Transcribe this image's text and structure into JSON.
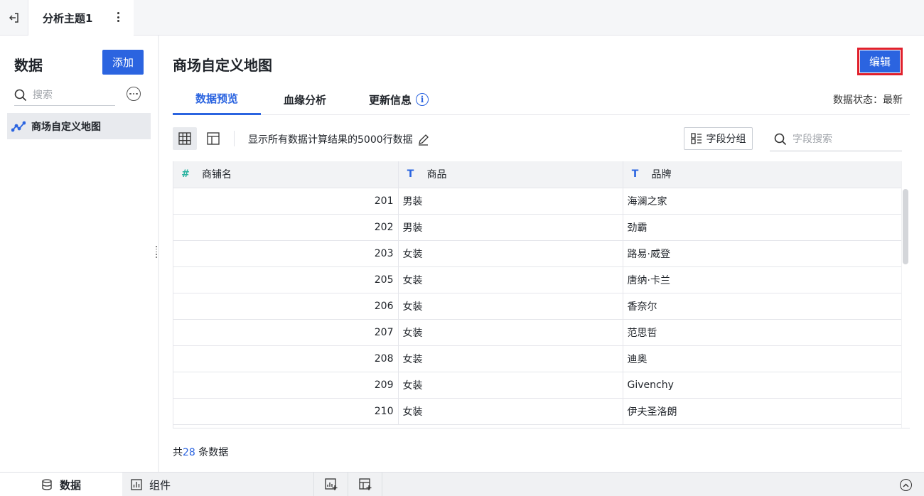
{
  "topbar": {
    "tab_title": "分析主题1"
  },
  "sidebar": {
    "title": "数据",
    "add_label": "添加",
    "search_placeholder": "搜索",
    "items": [
      {
        "label": "商场自定义地图"
      }
    ]
  },
  "main": {
    "title": "商场自定义地图",
    "edit_label": "编辑",
    "tabs": [
      {
        "label": "数据预览",
        "active": true
      },
      {
        "label": "血缘分析",
        "active": false
      },
      {
        "label": "更新信息",
        "active": false
      }
    ],
    "data_status": "数据状态：最新",
    "toolbar": {
      "description": "显示所有数据计算结果的5000行数据",
      "group_label": "字段分组",
      "field_search_placeholder": "字段搜索"
    },
    "table": {
      "columns": [
        {
          "label": "商铺名",
          "type_icon": "#"
        },
        {
          "label": "商品",
          "type_icon": "T"
        },
        {
          "label": "品牌",
          "type_icon": "T"
        }
      ],
      "rows": [
        [
          "201",
          "男装",
          "海澜之家"
        ],
        [
          "202",
          "男装",
          "劲霸"
        ],
        [
          "203",
          "女装",
          "路易·威登"
        ],
        [
          "205",
          "女装",
          "唐纳·卡兰"
        ],
        [
          "206",
          "女装",
          "香奈尔"
        ],
        [
          "207",
          "女装",
          "范思哲"
        ],
        [
          "208",
          "女装",
          "迪奥"
        ],
        [
          "209",
          "女装",
          "Givenchy"
        ],
        [
          "210",
          "女装",
          "伊夫圣洛朗"
        ]
      ]
    },
    "count": {
      "prefix": "共 ",
      "value": "28",
      "suffix": " 条数据"
    }
  },
  "bottombar": {
    "tabs": [
      {
        "label": "数据",
        "active": true
      },
      {
        "label": "组件",
        "active": false
      }
    ]
  },
  "colors": {
    "accent": "#2b64e0",
    "highlight_border": "#e0202c"
  }
}
